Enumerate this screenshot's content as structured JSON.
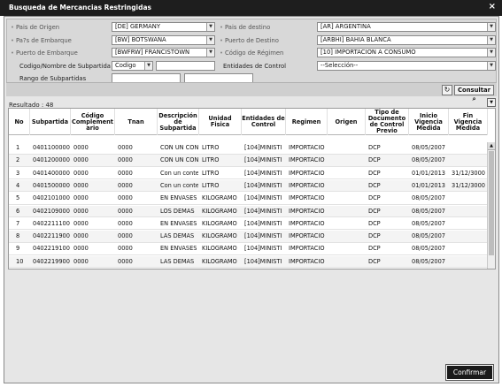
{
  "window": {
    "title": "Busqueda de Mercancias Restringidas",
    "close": "×"
  },
  "filters": {
    "pais_origen": {
      "label": "Pais de Origen",
      "value": "[DE] GERMANY"
    },
    "pais_destino": {
      "label": "Pais de destino",
      "value": "[AR] ARGENTINA"
    },
    "pais_embarque": {
      "label": "Pa?s de Embarque",
      "value": "[BW] BOTSWANA"
    },
    "puerto_destino": {
      "label": "Puerto de Destino",
      "value": "[ARBHI] BAHIA BLANCA"
    },
    "puerto_embarque": {
      "label": "Puerto de Embarque",
      "value": "[BWFRW] FRANCISTOWN"
    },
    "codigo_regimen": {
      "label": "Código de Régimen",
      "value": "[10] IMPORTACION A CONSUMO"
    },
    "codigo_subpartida": {
      "label": "Codigo/Nombre de Subpartida",
      "type_value": "Codigo",
      "text": ""
    },
    "entidades_control": {
      "label": "Entidades de Control",
      "value": "--Selección--"
    },
    "rango_subpartidas": {
      "label": "Rango de Subpartidas",
      "from": "",
      "to": ""
    }
  },
  "buttons": {
    "refresh_glyph": "↻",
    "consultar": "Consultar",
    "confirmar": "Confirmar",
    "dropdown_glyph": "▼"
  },
  "result_label": "Resultado : 48",
  "table": {
    "headers": [
      "No",
      "Subpartida",
      "Código Complement ario",
      "Tnan",
      "Descripción de Subpartida",
      "Unidad Fisica",
      "Entidades de Control",
      "Regimen",
      "Origen",
      "Tipo de Documento de Control Previo",
      "Inicio Vigencia Medida",
      "Fin Vigencia Medida"
    ],
    "rows": [
      [
        "1",
        "0401100000",
        "0000",
        "0000",
        "CON UN CON",
        "LITRO",
        "[104]MINISTI",
        "IMPORTACIO",
        "",
        "DCP",
        "08/05/2007",
        ""
      ],
      [
        "2",
        "0401200000",
        "0000",
        "0000",
        "CON UN CON",
        "LITRO",
        "[104]MINISTI",
        "IMPORTACIO",
        "",
        "DCP",
        "08/05/2007",
        ""
      ],
      [
        "3",
        "0401400000",
        "0000",
        "0000",
        "Con un conte",
        "LITRO",
        "[104]MINISTI",
        "IMPORTACIO",
        "",
        "DCP",
        "01/01/2013",
        "31/12/3000"
      ],
      [
        "4",
        "0401500000",
        "0000",
        "0000",
        "Con un conte",
        "LITRO",
        "[104]MINISTI",
        "IMPORTACIO",
        "",
        "DCP",
        "01/01/2013",
        "31/12/3000"
      ],
      [
        "5",
        "0402101000",
        "0000",
        "0000",
        "EN ENVASES",
        "KILOGRAMO",
        "[104]MINISTI",
        "IMPORTACIO",
        "",
        "DCP",
        "08/05/2007",
        ""
      ],
      [
        "6",
        "0402109000",
        "0000",
        "0000",
        "LOS DEMAS",
        "KILOGRAMO",
        "[104]MINISTI",
        "IMPORTACIO",
        "",
        "DCP",
        "08/05/2007",
        ""
      ],
      [
        "7",
        "0402211100",
        "0000",
        "0000",
        "EN ENVASES",
        "KILOGRAMO",
        "[104]MINISTI",
        "IMPORTACIO",
        "",
        "DCP",
        "08/05/2007",
        ""
      ],
      [
        "8",
        "0402211900",
        "0000",
        "0000",
        "LAS DEMAS",
        "KILOGRAMO",
        "[104]MINISTI",
        "IMPORTACIO",
        "",
        "DCP",
        "08/05/2007",
        ""
      ],
      [
        "9",
        "0402219100",
        "0000",
        "0000",
        "EN ENVASES",
        "KILOGRAMO",
        "[104]MINISTI",
        "IMPORTACIO",
        "",
        "DCP",
        "08/05/2007",
        ""
      ],
      [
        "10",
        "0402219900",
        "0000",
        "0000",
        "LAS DEMAS",
        "KILOGRAMO",
        "[104]MINISTI",
        "IMPORTACIO",
        "",
        "DCP",
        "08/05/2007",
        ""
      ]
    ]
  }
}
